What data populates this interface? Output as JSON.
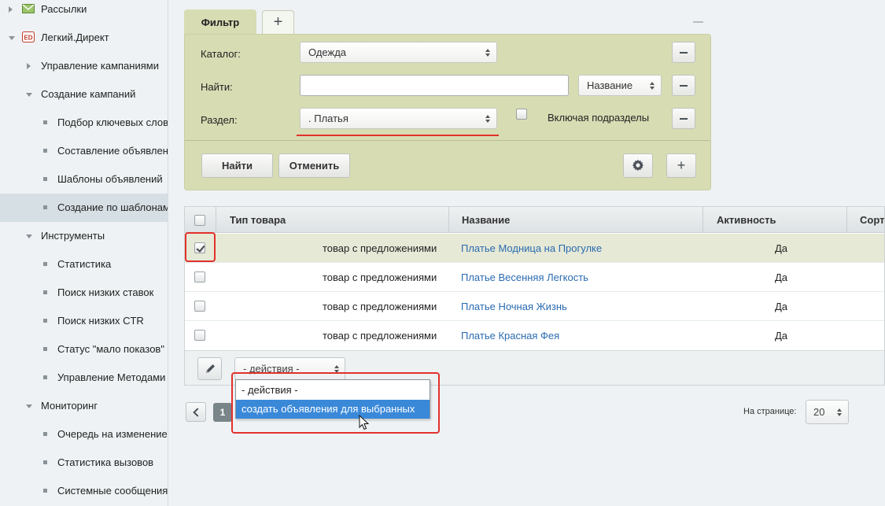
{
  "sidebar": {
    "items": [
      {
        "label": "Рассылки",
        "icon": "envelope-icon"
      },
      {
        "label": "Легкий.Директ",
        "icon": "ed-logo-icon"
      },
      {
        "label": "Управление кампаниями"
      },
      {
        "label": "Создание кампаний"
      },
      {
        "label": "Подбор ключевых слов"
      },
      {
        "label": "Составление объявлений"
      },
      {
        "label": "Шаблоны объявлений"
      },
      {
        "label": "Создание по шаблонам"
      },
      {
        "label": "Инструменты"
      },
      {
        "label": "Статистика"
      },
      {
        "label": "Поиск низких ставок"
      },
      {
        "label": "Поиск низких CTR"
      },
      {
        "label": "Статус \"мало показов\""
      },
      {
        "label": "Управление Методами"
      },
      {
        "label": "Мониторинг"
      },
      {
        "label": "Очередь на изменение"
      },
      {
        "label": "Статистика вызовов"
      },
      {
        "label": "Системные сообщения"
      }
    ],
    "active_item": "Создание по шаблонам"
  },
  "filter": {
    "tab_label": "Фильтр",
    "add_tab_label": "+",
    "catalog_label": "Каталог:",
    "catalog_value": "Одежда",
    "find_label": "Найти:",
    "find_value": "",
    "find_field_value": "Название",
    "section_label": "Раздел:",
    "section_value": ". Платья",
    "include_subsections_label": "Включая подразделы",
    "include_subsections_checked": false,
    "find_button": "Найти",
    "cancel_button": "Отменить",
    "add_button": "+"
  },
  "grid": {
    "columns": [
      "Тип товара",
      "Название",
      "Активность",
      "Сорт"
    ],
    "rows": [
      {
        "type": "товар с предложениями",
        "name": "Платье Модница на Прогулке",
        "active": "Да",
        "checked": true
      },
      {
        "type": "товар с предложениями",
        "name": "Платье Весенняя Легкость",
        "active": "Да",
        "checked": false
      },
      {
        "type": "товар с предложениями",
        "name": "Платье Ночная Жизнь",
        "active": "Да",
        "checked": false
      },
      {
        "type": "товар с предложениями",
        "name": "Платье Красная Фея",
        "active": "Да",
        "checked": false
      }
    ],
    "actions_value": "- действия -",
    "actions_options": [
      "- действия -",
      "создать объявления для выбранных"
    ],
    "actions_highlighted": "создать объявления для выбранных"
  },
  "pager": {
    "current_page": "1",
    "per_page_label": "На странице:",
    "per_page_value": "20"
  },
  "colors": {
    "filter_bg": "#d7dcb3",
    "highlight_red": "#e2312c",
    "link_blue": "#2a6bb0",
    "dropdown_hover": "#3a89d9"
  }
}
